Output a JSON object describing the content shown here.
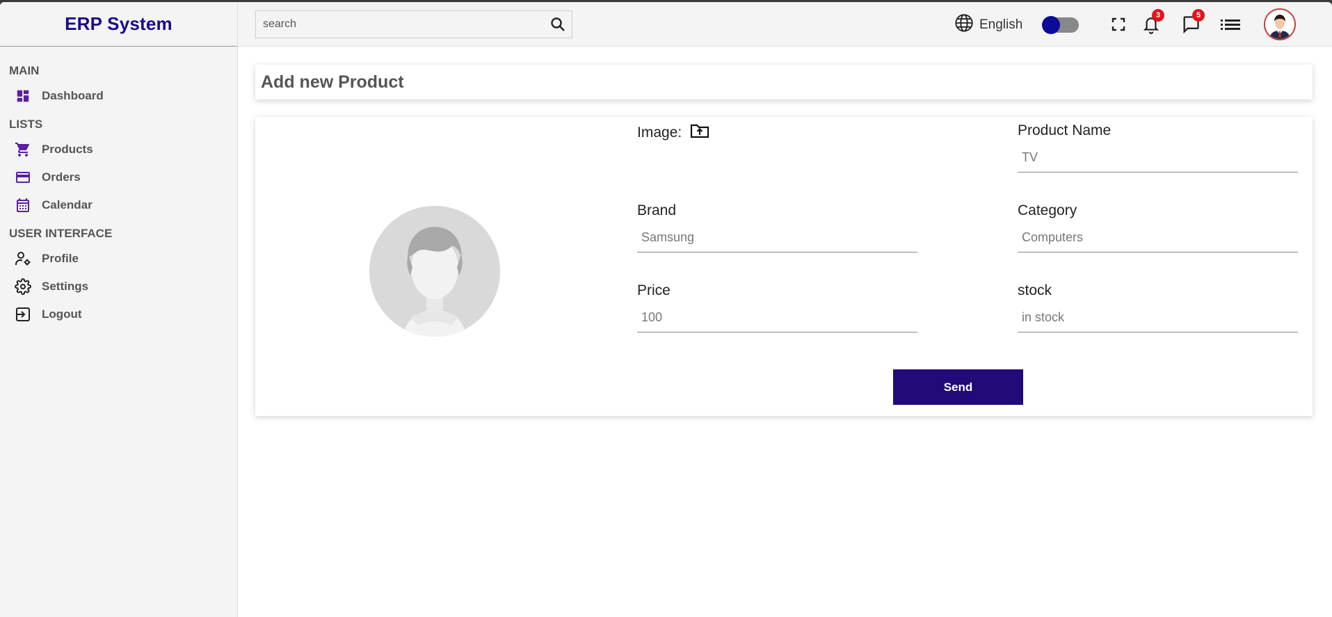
{
  "app": {
    "title": "ERP System"
  },
  "sidebar": {
    "sections": [
      {
        "title": "MAIN",
        "items": [
          {
            "label": "Dashboard",
            "icon": "dashboard-icon"
          }
        ]
      },
      {
        "title": "LISTS",
        "items": [
          {
            "label": "Products",
            "icon": "cart-icon"
          },
          {
            "label": "Orders",
            "icon": "credit-card-icon"
          },
          {
            "label": "Calendar",
            "icon": "calendar-icon"
          }
        ]
      },
      {
        "title": "USER INTERFACE",
        "items": [
          {
            "label": "Profile",
            "icon": "profile-settings-icon"
          },
          {
            "label": "Settings",
            "icon": "gear-icon"
          },
          {
            "label": "Logout",
            "icon": "logout-icon"
          }
        ]
      }
    ]
  },
  "topbar": {
    "search": {
      "placeholder": "search",
      "value": ""
    },
    "language": "English",
    "dark_mode_toggle": "on",
    "notifications_count": "3",
    "messages_count": "5"
  },
  "page": {
    "title": "Add new Product",
    "form": {
      "image_label": "Image:",
      "product_name": {
        "label": "Product Name",
        "placeholder": "TV"
      },
      "brand": {
        "label": "Brand",
        "placeholder": "Samsung"
      },
      "category": {
        "label": "Category",
        "placeholder": "Computers"
      },
      "price": {
        "label": "Price",
        "placeholder": "100"
      },
      "stock": {
        "label": "stock",
        "placeholder": "in stock"
      },
      "submit_label": "Send"
    }
  },
  "colors": {
    "brand": "#1a0a8c",
    "accent_icon": "#5b1fa0",
    "button": "#220a78",
    "badge": "#e3141b"
  }
}
